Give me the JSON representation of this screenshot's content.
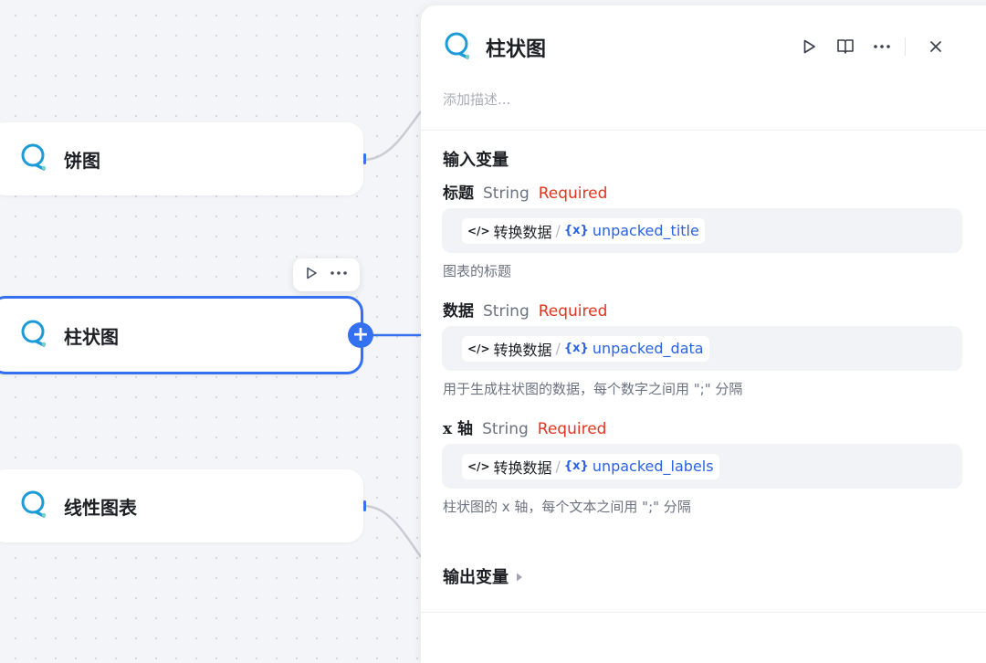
{
  "canvas": {
    "nodes": [
      {
        "id": "pie",
        "title": "饼图"
      },
      {
        "id": "bar",
        "title": "柱状图",
        "selected": true
      },
      {
        "id": "line",
        "title": "线性图表"
      }
    ],
    "toolbar_icons": [
      "run-icon",
      "more-icon"
    ]
  },
  "panel": {
    "title": "柱状图",
    "description_placeholder": "添加描述...",
    "actions": [
      "run-icon",
      "docs-icon",
      "more-icon",
      "close-icon"
    ],
    "input_section_title": "输入变量",
    "inputs": [
      {
        "name": "标题",
        "type": "String",
        "required": "Required",
        "ref_source": "转换数据",
        "ref_separator": "/",
        "ref_var_marker": "{x}",
        "ref_var": "unpacked_title",
        "help": "图表的标题"
      },
      {
        "name": "数据",
        "type": "String",
        "required": "Required",
        "ref_source": "转换数据",
        "ref_separator": "/",
        "ref_var_marker": "{x}",
        "ref_var": "unpacked_data",
        "help": "用于生成柱状图的数据，每个数字之间用 \";\" 分隔"
      },
      {
        "name": "x 轴",
        "type": "String",
        "required": "Required",
        "ref_source": "转换数据",
        "ref_separator": "/",
        "ref_var_marker": "{x}",
        "ref_var": "unpacked_labels",
        "help": "柱状图的 x 轴，每个文本之间用 \";\" 分隔"
      }
    ],
    "output_section_title": "输出变量"
  },
  "colors": {
    "accent": "#3470f0",
    "required": "#e0351f",
    "variable": "#2a63e0",
    "icon_ring": "#1d9bd8"
  }
}
